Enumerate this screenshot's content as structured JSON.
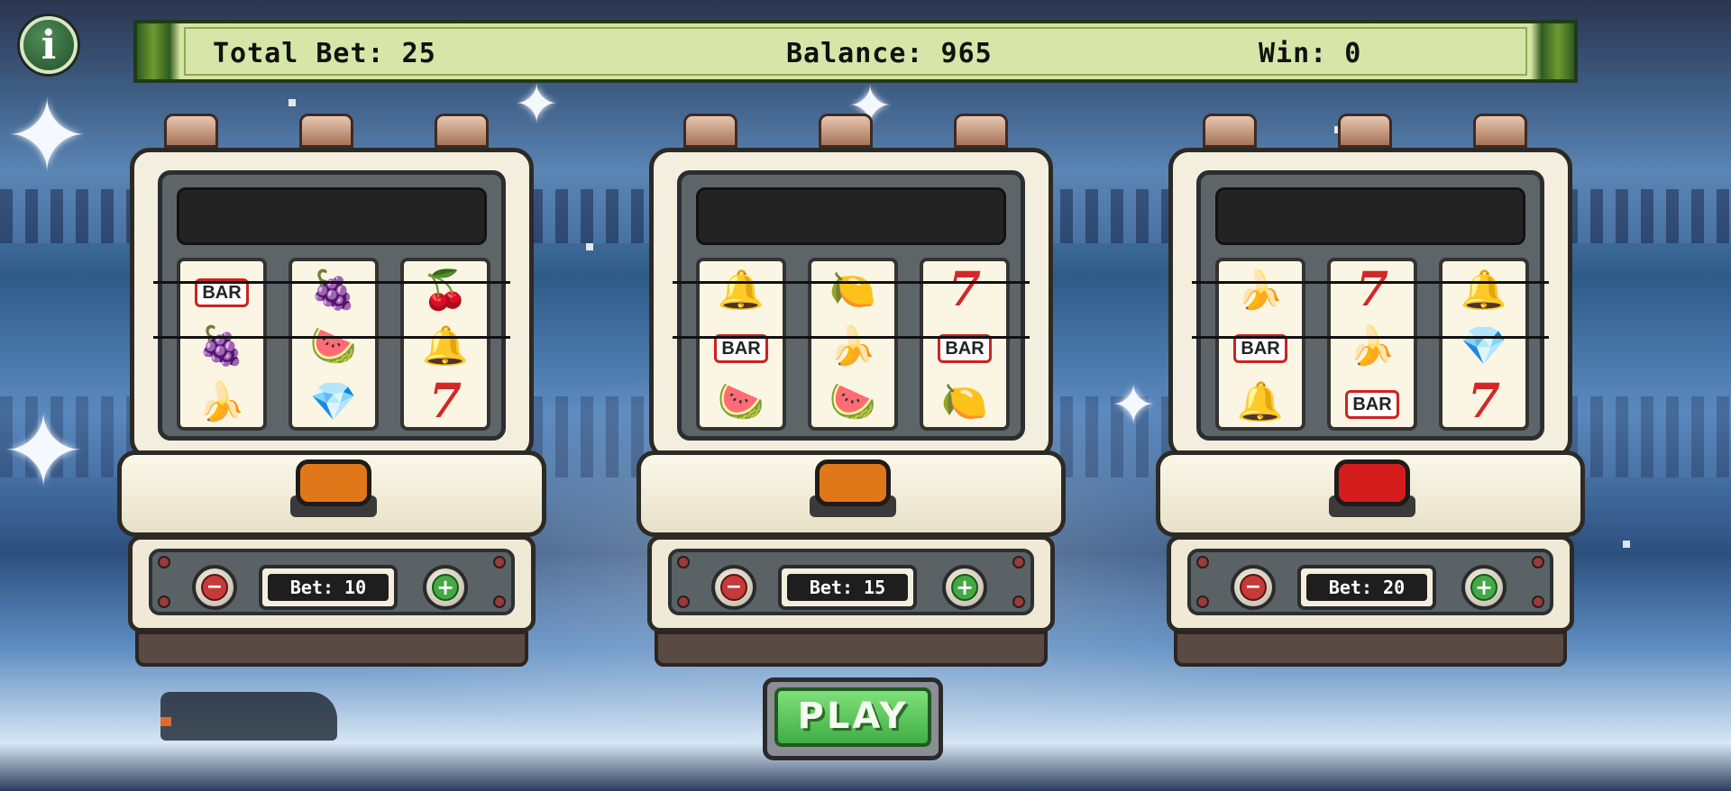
{
  "hud": {
    "total_bet": "Total Bet: 25",
    "balance": "Balance: 965",
    "win": "Win: 0"
  },
  "info_button": {
    "label": "i"
  },
  "machines": [
    {
      "spin_color": "#e0781a",
      "bet_label": "Bet: 10",
      "reels": [
        [
          {
            "sym": "bar",
            "text": "BAR"
          },
          {
            "sym": "plum",
            "text": "🍇"
          },
          {
            "sym": "banana",
            "text": "🍌"
          }
        ],
        [
          {
            "sym": "plum",
            "text": "🍇"
          },
          {
            "sym": "melon",
            "text": "🍉"
          },
          {
            "sym": "diamond",
            "text": "💎"
          }
        ],
        [
          {
            "sym": "cherry",
            "text": "🍒"
          },
          {
            "sym": "bell",
            "text": "🔔"
          },
          {
            "sym": "seven",
            "text": "7"
          }
        ]
      ]
    },
    {
      "spin_color": "#e0781a",
      "bet_label": "Bet: 15",
      "reels": [
        [
          {
            "sym": "bell",
            "text": "🔔"
          },
          {
            "sym": "bar",
            "text": "BAR"
          },
          {
            "sym": "melon",
            "text": "🍉"
          }
        ],
        [
          {
            "sym": "lemon",
            "text": "🍋"
          },
          {
            "sym": "banana",
            "text": "🍌"
          },
          {
            "sym": "melon",
            "text": "🍉"
          }
        ],
        [
          {
            "sym": "seven",
            "text": "7"
          },
          {
            "sym": "bar",
            "text": "BAR"
          },
          {
            "sym": "lemon",
            "text": "🍋"
          }
        ]
      ]
    },
    {
      "spin_color": "#d41c1c",
      "bet_label": "Bet: 20",
      "reels": [
        [
          {
            "sym": "banana",
            "text": "🍌"
          },
          {
            "sym": "bar",
            "text": "BAR"
          },
          {
            "sym": "bell",
            "text": "🔔"
          }
        ],
        [
          {
            "sym": "seven",
            "text": "7"
          },
          {
            "sym": "banana",
            "text": "🍌"
          },
          {
            "sym": "bar",
            "text": "BAR"
          }
        ],
        [
          {
            "sym": "bell",
            "text": "🔔"
          },
          {
            "sym": "diamond",
            "text": "💎"
          },
          {
            "sym": "seven",
            "text": "7"
          }
        ]
      ]
    }
  ],
  "bet_controls": {
    "minus": "−",
    "plus": "+"
  },
  "play_button": {
    "label": "PLAY"
  }
}
